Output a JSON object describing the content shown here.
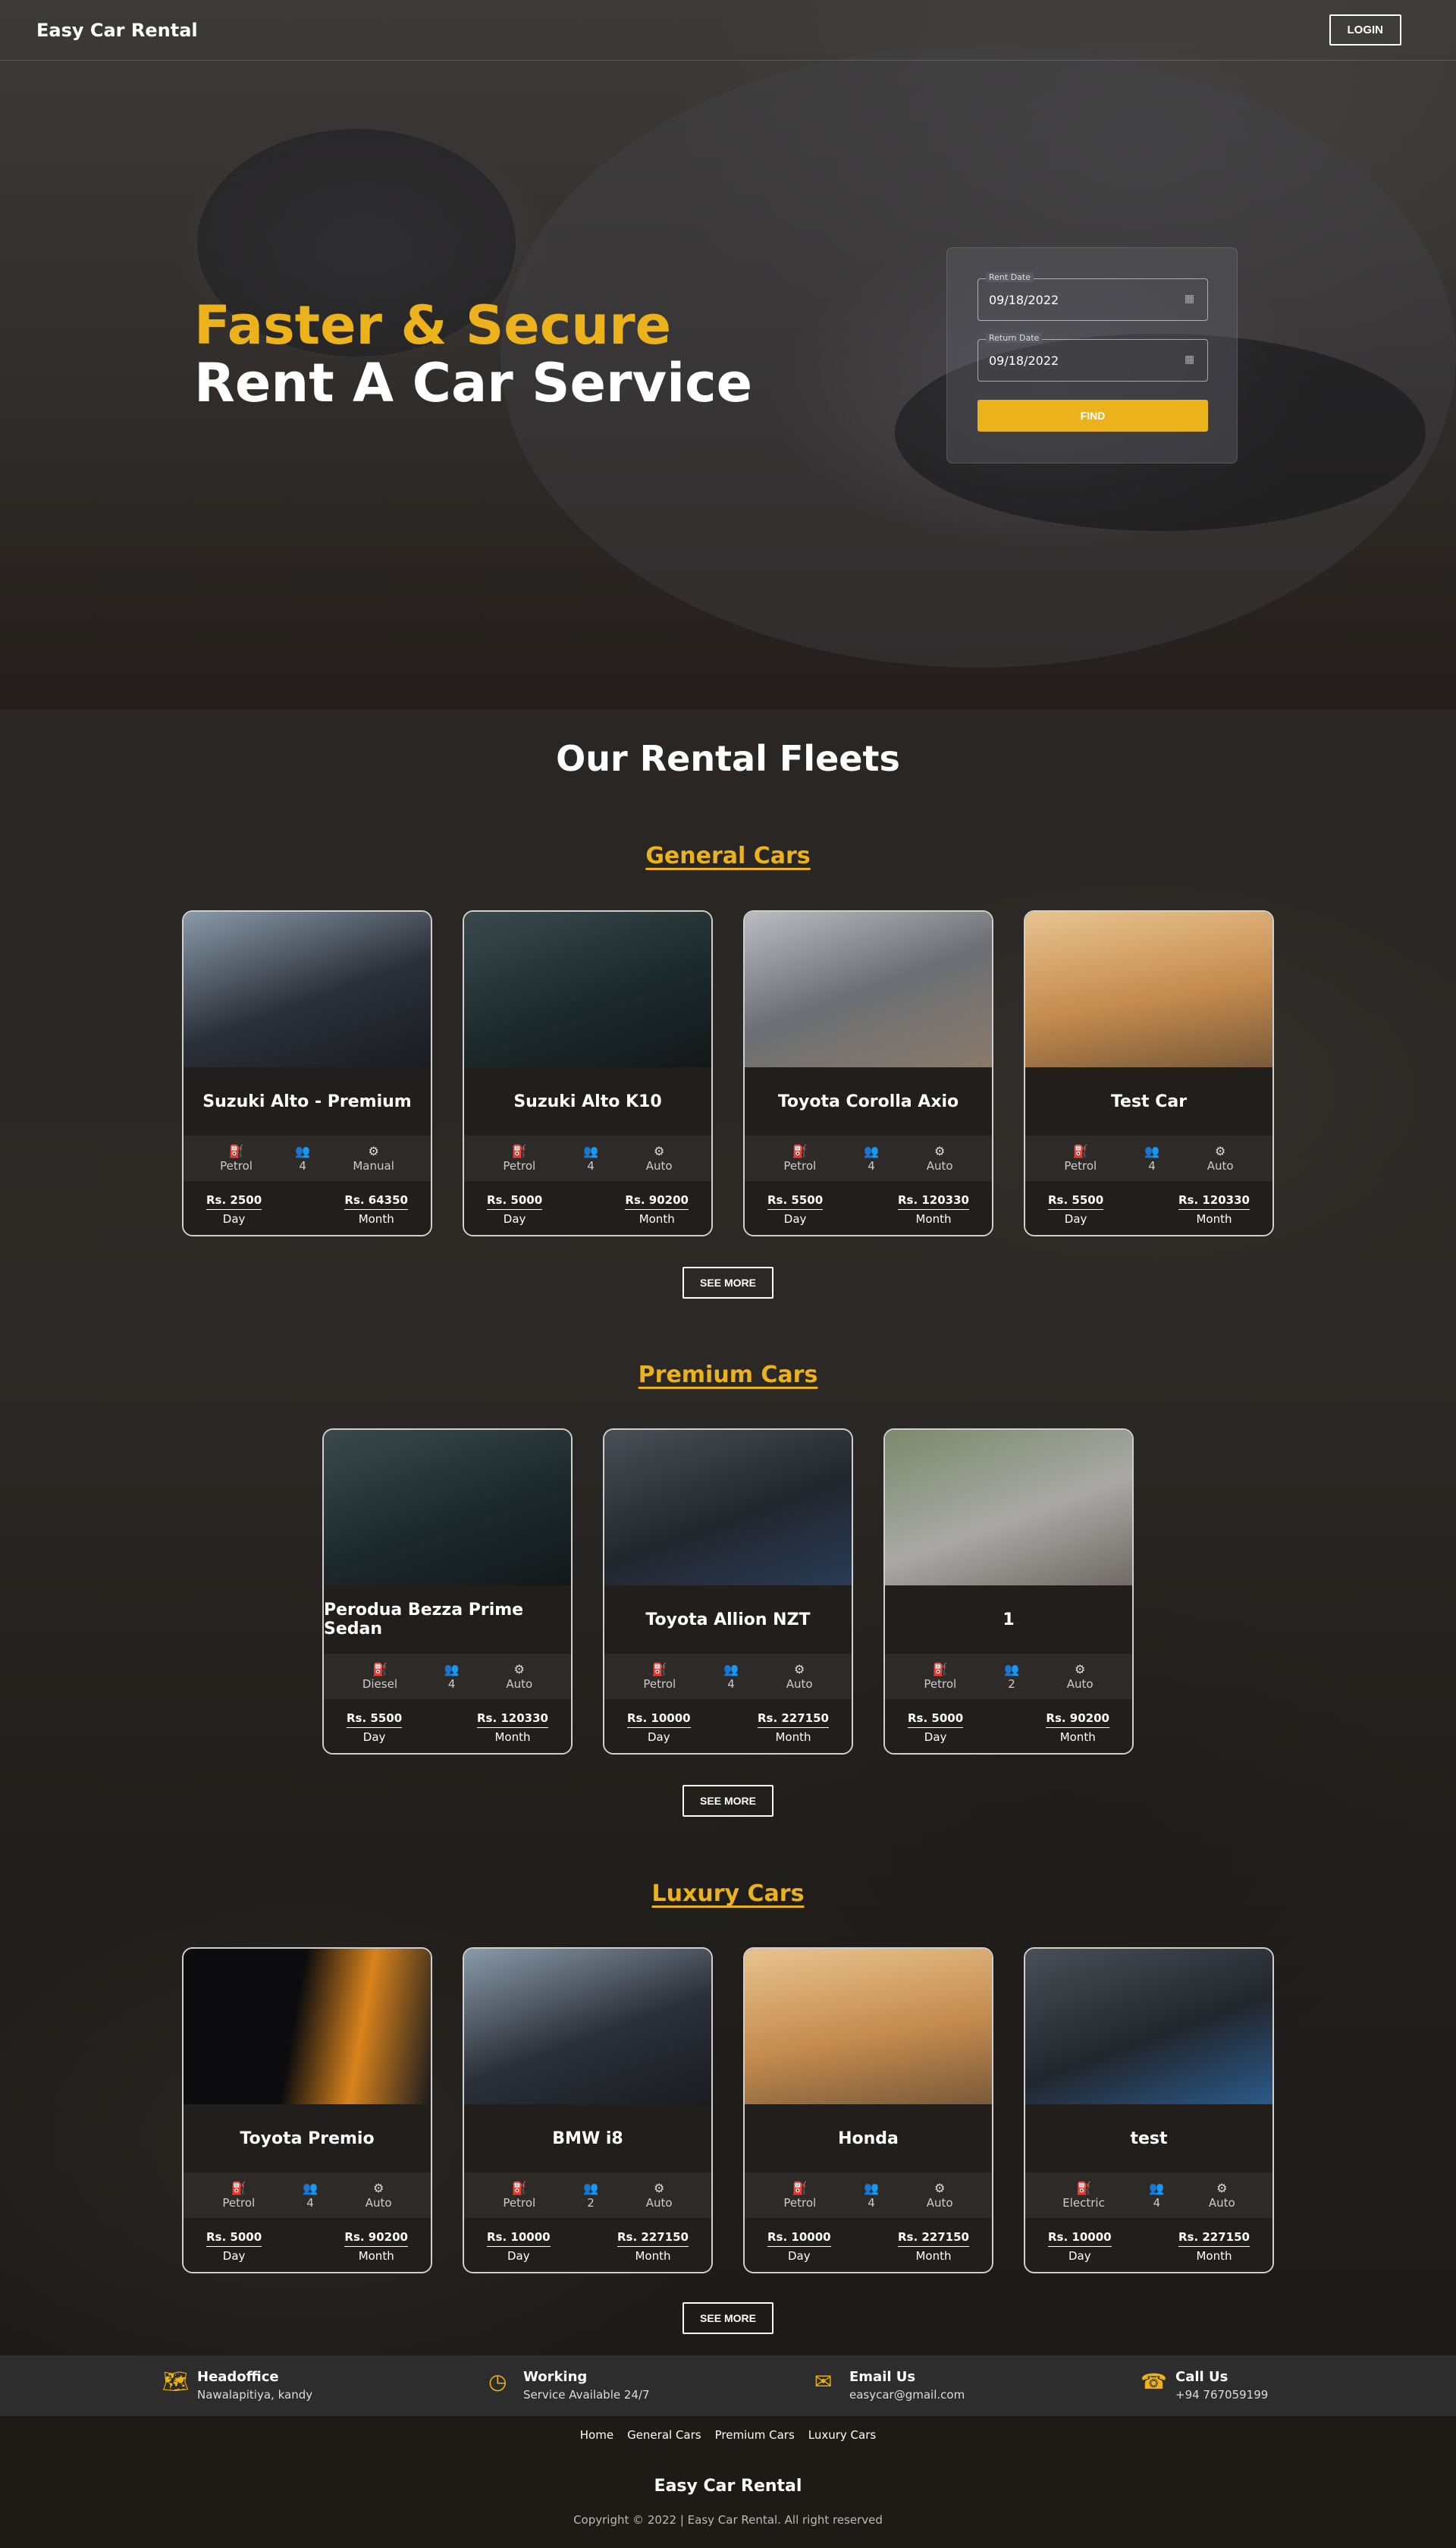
{
  "nav": {
    "brand": "Easy Car Rental",
    "login": "LOGIN"
  },
  "hero": {
    "line1": "Faster & Secure",
    "line2": "Rent A Car Service",
    "rent_label": "Rent Date",
    "rent_value": "09/18/2022",
    "return_label": "Return Date",
    "return_value": "09/18/2022",
    "find": "FIND"
  },
  "fleets": {
    "title": "Our Rental Fleets",
    "see_more": "SEE MORE",
    "general": {
      "title": "General Cars",
      "cars": [
        {
          "name": "Suzuki Alto - Premium",
          "fuel": "Petrol",
          "seats": "4",
          "trans": "Manual",
          "day": "Rs. 2500",
          "month": "Rs. 64350"
        },
        {
          "name": "Suzuki Alto K10",
          "fuel": "Petrol",
          "seats": "4",
          "trans": "Auto",
          "day": "Rs. 5000",
          "month": "Rs. 90200"
        },
        {
          "name": "Toyota Corolla Axio",
          "fuel": "Petrol",
          "seats": "4",
          "trans": "Auto",
          "day": "Rs. 5500",
          "month": "Rs. 120330"
        },
        {
          "name": "Test Car",
          "fuel": "Petrol",
          "seats": "4",
          "trans": "Auto",
          "day": "Rs. 5500",
          "month": "Rs. 120330"
        }
      ]
    },
    "premium": {
      "title": "Premium Cars",
      "cars": [
        {
          "name": "Perodua Bezza Prime Sedan",
          "fuel": "Diesel",
          "seats": "4",
          "trans": "Auto",
          "day": "Rs. 5500",
          "month": "Rs. 120330"
        },
        {
          "name": "Toyota Allion NZT",
          "fuel": "Petrol",
          "seats": "4",
          "trans": "Auto",
          "day": "Rs. 10000",
          "month": "Rs. 227150"
        },
        {
          "name": "1",
          "fuel": "Petrol",
          "seats": "2",
          "trans": "Auto",
          "day": "Rs. 5000",
          "month": "Rs. 90200"
        }
      ]
    },
    "luxury": {
      "title": "Luxury Cars",
      "cars": [
        {
          "name": "Toyota Premio",
          "fuel": "Petrol",
          "seats": "4",
          "trans": "Auto",
          "day": "Rs. 5000",
          "month": "Rs. 90200"
        },
        {
          "name": "BMW i8",
          "fuel": "Petrol",
          "seats": "2",
          "trans": "Auto",
          "day": "Rs. 10000",
          "month": "Rs. 227150"
        },
        {
          "name": "Honda",
          "fuel": "Petrol",
          "seats": "4",
          "trans": "Auto",
          "day": "Rs. 10000",
          "month": "Rs. 227150"
        },
        {
          "name": "test",
          "fuel": "Electric",
          "seats": "4",
          "trans": "Auto",
          "day": "Rs. 10000",
          "month": "Rs. 227150"
        }
      ]
    },
    "day_label": "Day",
    "month_label": "Month"
  },
  "info": {
    "office_title": "Headoffice",
    "office_text": "Nawalapitiya, kandy",
    "work_title": "Working",
    "work_text": "Service Available 24/7",
    "email_title": "Email Us",
    "email_text": "easycar@gmail.com",
    "call_title": "Call Us",
    "call_text": "+94 767059199"
  },
  "footer": {
    "links": [
      "Home",
      "General Cars",
      "Premium Cars",
      "Luxury Cars"
    ],
    "brand": "Easy Car Rental",
    "copyright": "Copyright © 2022 | Easy Car Rental. All right reserved"
  },
  "colors": {
    "accent": "#ecb21b",
    "bg": "#1e1b18"
  }
}
